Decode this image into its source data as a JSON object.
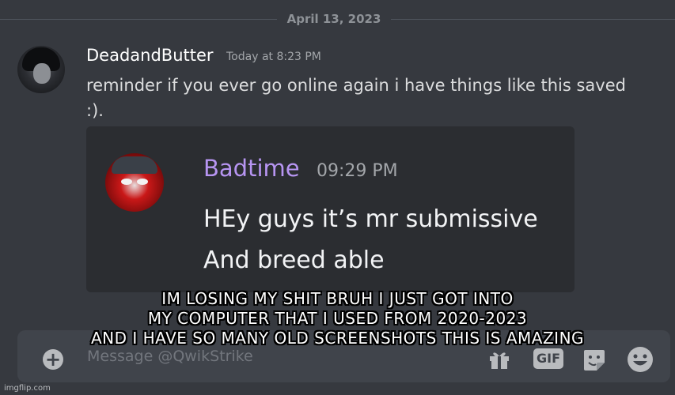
{
  "date_divider": "April 13, 2023",
  "message": {
    "username": "DeadandButter",
    "timestamp": "Today at 8:23 PM",
    "text_line1": "reminder if you ever go online again i have things like this saved",
    "text_line2": ":)."
  },
  "embed": {
    "name": "Badtime",
    "time": "09:29 PM",
    "line1": "HEy guys it’s mr submissive",
    "line2": "And breed able",
    "name_color": "#b795f2"
  },
  "composer": {
    "add_symbol": "+",
    "placeholder": "Message @QwikStrike",
    "gif_label": "GIF",
    "icons": [
      "add-icon",
      "gift-icon",
      "gif-icon",
      "sticker-icon",
      "emoji-icon"
    ]
  },
  "caption": {
    "line1": "IM LOSING MY SHIT BRUH I JUST GOT INTO",
    "line2": "MY COMPUTER THAT I USED FROM 2020-2023",
    "line3": "AND I HAVE SO MANY OLD SCREENSHOTS THIS IS AMAZING"
  },
  "watermark": "imgflip.com"
}
